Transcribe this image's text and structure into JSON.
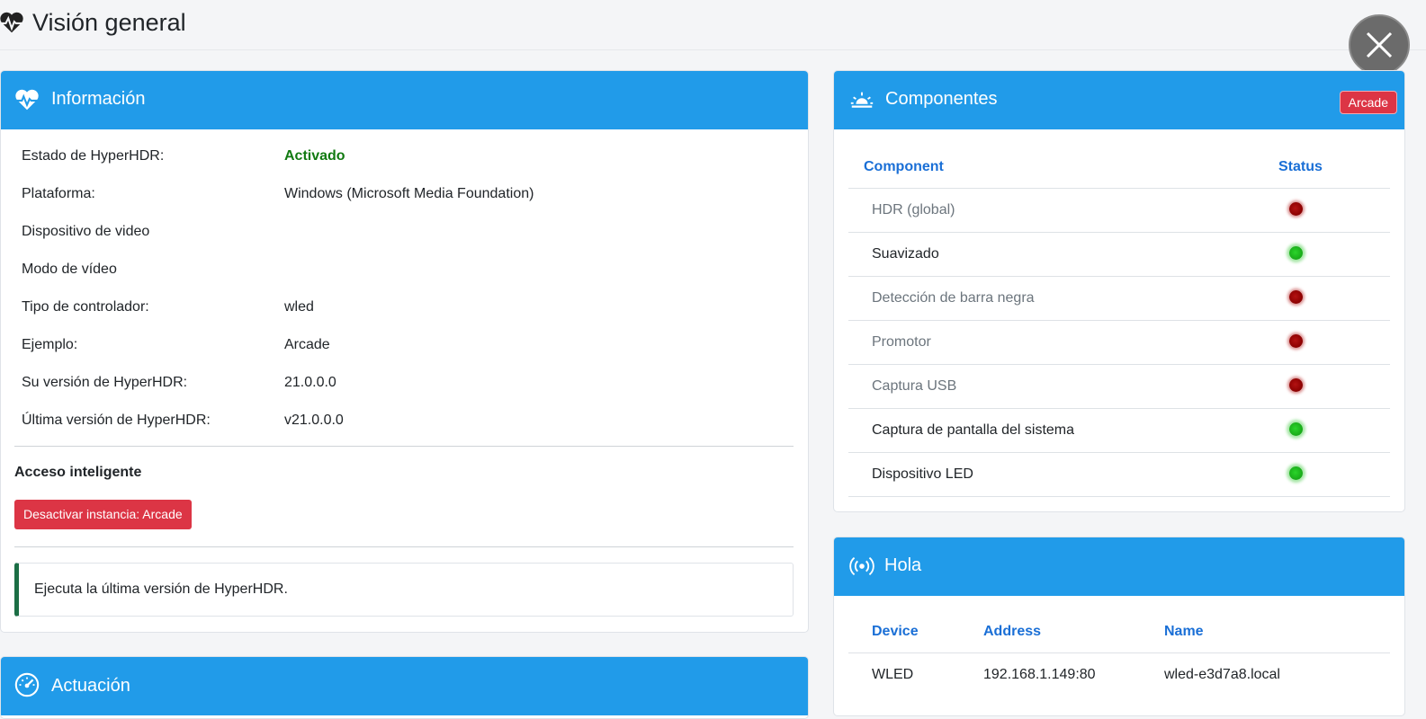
{
  "header": {
    "title": "Visión general",
    "icon": "heartbeat-icon"
  },
  "info_card": {
    "title": "Información",
    "icon": "heart-pulse-icon",
    "rows": [
      {
        "label": "Estado de HyperHDR:",
        "value": "Activado",
        "status": "green"
      },
      {
        "label": "Plataforma:",
        "value": "Windows (Microsoft Media Foundation)"
      },
      {
        "label": "Dispositivo de video",
        "value": ""
      },
      {
        "label": "Modo de vídeo",
        "value": ""
      },
      {
        "label": "Tipo de controlador:",
        "value": "wled"
      },
      {
        "label": "Ejemplo:",
        "value": "Arcade"
      },
      {
        "label": "Su versión de HyperHDR:",
        "value": "21.0.0.0"
      },
      {
        "label": "Última versión de HyperHDR:",
        "value": "v21.0.0.0"
      }
    ],
    "smart_access_title": "Acceso inteligente",
    "deactivate_button": "Desactivar instancia: Arcade",
    "alert_text": "Ejecuta la última versión de HyperHDR."
  },
  "performance_card": {
    "title": "Actuación",
    "icon": "speedometer-icon"
  },
  "components_card": {
    "title": "Componentes",
    "icon": "sunrise-icon",
    "badge": "Arcade",
    "col_component": "Component",
    "col_status": "Status",
    "rows": [
      {
        "label": "HDR (global)",
        "status": "red"
      },
      {
        "label": "Suavizado",
        "status": "green"
      },
      {
        "label": "Detección de barra negra",
        "status": "red"
      },
      {
        "label": "Promotor",
        "status": "red"
      },
      {
        "label": "Captura USB",
        "status": "red"
      },
      {
        "label": "Captura de pantalla del sistema",
        "status": "green"
      },
      {
        "label": "Dispositivo LED",
        "status": "green"
      }
    ]
  },
  "hello_card": {
    "title": "Hola",
    "icon": "broadcast-icon",
    "col_device": "Device",
    "col_address": "Address",
    "col_name": "Name",
    "rows": [
      {
        "device": "WLED",
        "address": "192.168.1.149:80",
        "name": "wled-e3d7a8.local"
      }
    ]
  },
  "colors": {
    "accent": "#219be9",
    "danger": "#dc3545",
    "ok": "#117a11"
  }
}
